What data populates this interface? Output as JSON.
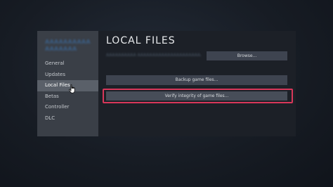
{
  "sidebar": {
    "game_title": "AAAAAAAAAA AAAAAAA",
    "items": [
      {
        "label": "General"
      },
      {
        "label": "Updates"
      },
      {
        "label": "Local Files"
      },
      {
        "label": "Betas"
      },
      {
        "label": "Controller"
      },
      {
        "label": "DLC"
      }
    ]
  },
  "main": {
    "heading": "LOCAL FILES",
    "path_text": "AAAAAAAAAA AAAAAAAAAAAAAAAAAAAAAAAAAA",
    "browse_label": "Browse...",
    "backup_label": "Backup game files...",
    "verify_label": "Verify integrity of game files..."
  },
  "colors": {
    "highlight": "#d8375a",
    "sidebar_bg": "#3a3f47",
    "active_item_bg": "#5a6069"
  }
}
